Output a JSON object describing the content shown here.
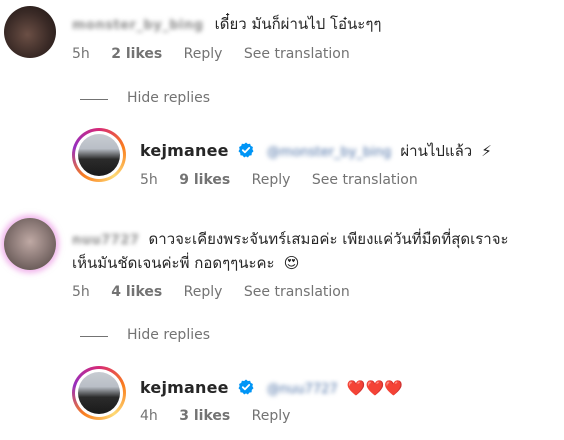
{
  "comments": [
    {
      "username": "monster_by_bing",
      "text": "เดี๋ยว มันก็ผ่านไป โอ๋นะๆๆ",
      "time": "5h",
      "likes": "2 likes",
      "reply": "Reply",
      "translate": "See translation",
      "hide_replies": "Hide replies",
      "reply_comment": {
        "username": "kejmanee",
        "mention": "@monster_by_bing",
        "text": "ผ่านไปแล้ว",
        "emoji": "⚡",
        "time": "5h",
        "likes": "9 likes",
        "reply": "Reply",
        "translate": "See translation"
      }
    },
    {
      "username": "nuu7727",
      "text_line1": "ดาวจะเคียงพระจันทร์เสมอค่ะ เพียงแค่วันที่มืดที่สุดเราจะ",
      "text_line2": "เห็นมันชัดเจนค่ะพี่ กอดๆๆนะคะ",
      "emoji": "😍",
      "time": "5h",
      "likes": "4 likes",
      "reply": "Reply",
      "translate": "See translation",
      "hide_replies": "Hide replies",
      "reply_comment": {
        "username": "kejmanee",
        "mention": "@nuu7727",
        "emoji": "❤️❤️❤️",
        "time": "4h",
        "likes": "3 likes",
        "reply": "Reply"
      }
    }
  ],
  "colors": {
    "verified": "#0095f6",
    "meta_text": "#737373",
    "heart": "#e0245e"
  }
}
